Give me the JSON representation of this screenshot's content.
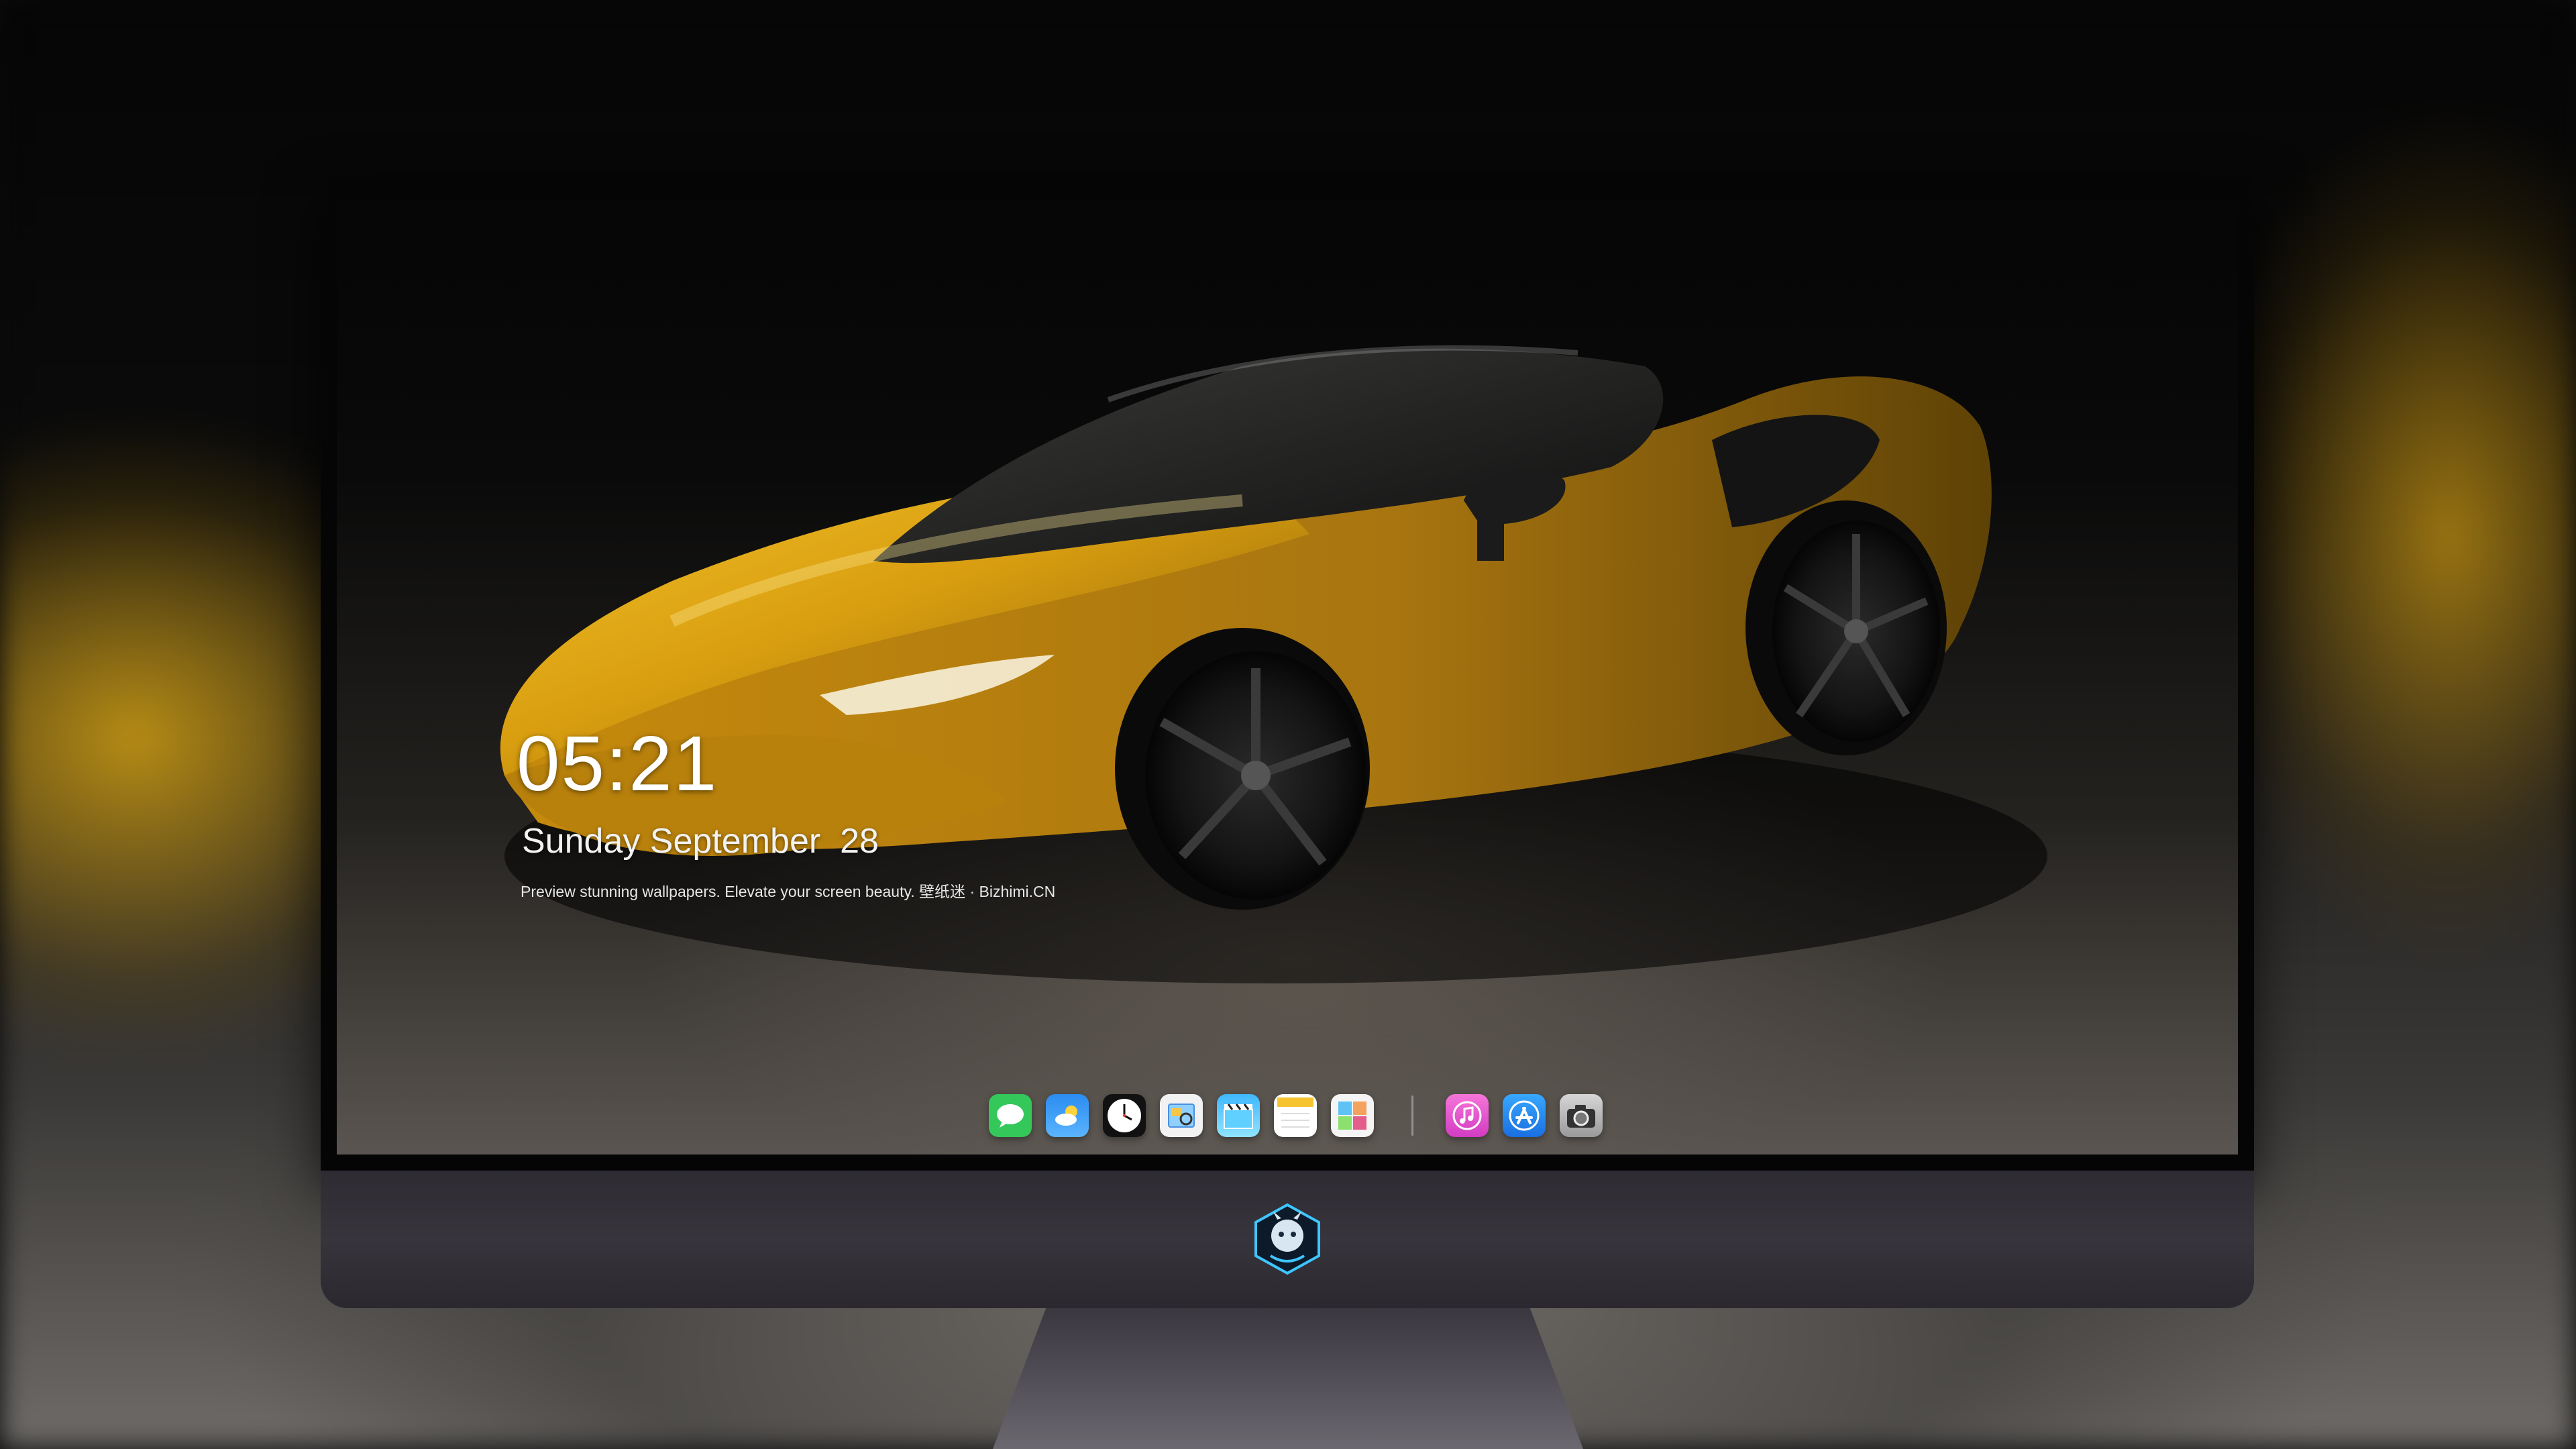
{
  "lockscreen": {
    "time": "05:21",
    "date": "Sunday September  28",
    "tagline": "Preview stunning wallpapers. Elevate your screen beauty. 壁纸迷 · Bizhimi.CN"
  },
  "dock": {
    "apps": [
      {
        "name": "messages-icon"
      },
      {
        "name": "weather-icon"
      },
      {
        "name": "clock-icon"
      },
      {
        "name": "preview-icon"
      },
      {
        "name": "clips-icon"
      },
      {
        "name": "notes-icon"
      },
      {
        "name": "photo-booth-icon"
      },
      {
        "name": "music-icon"
      },
      {
        "name": "app-store-icon"
      },
      {
        "name": "camera-icon"
      }
    ]
  },
  "colors": {
    "car_body": "#e0a814",
    "monitor_chin": "#34313a",
    "messages_green": "#34c759",
    "app_store_blue": "#1a8cff",
    "music_pink": "#e94bd6"
  }
}
